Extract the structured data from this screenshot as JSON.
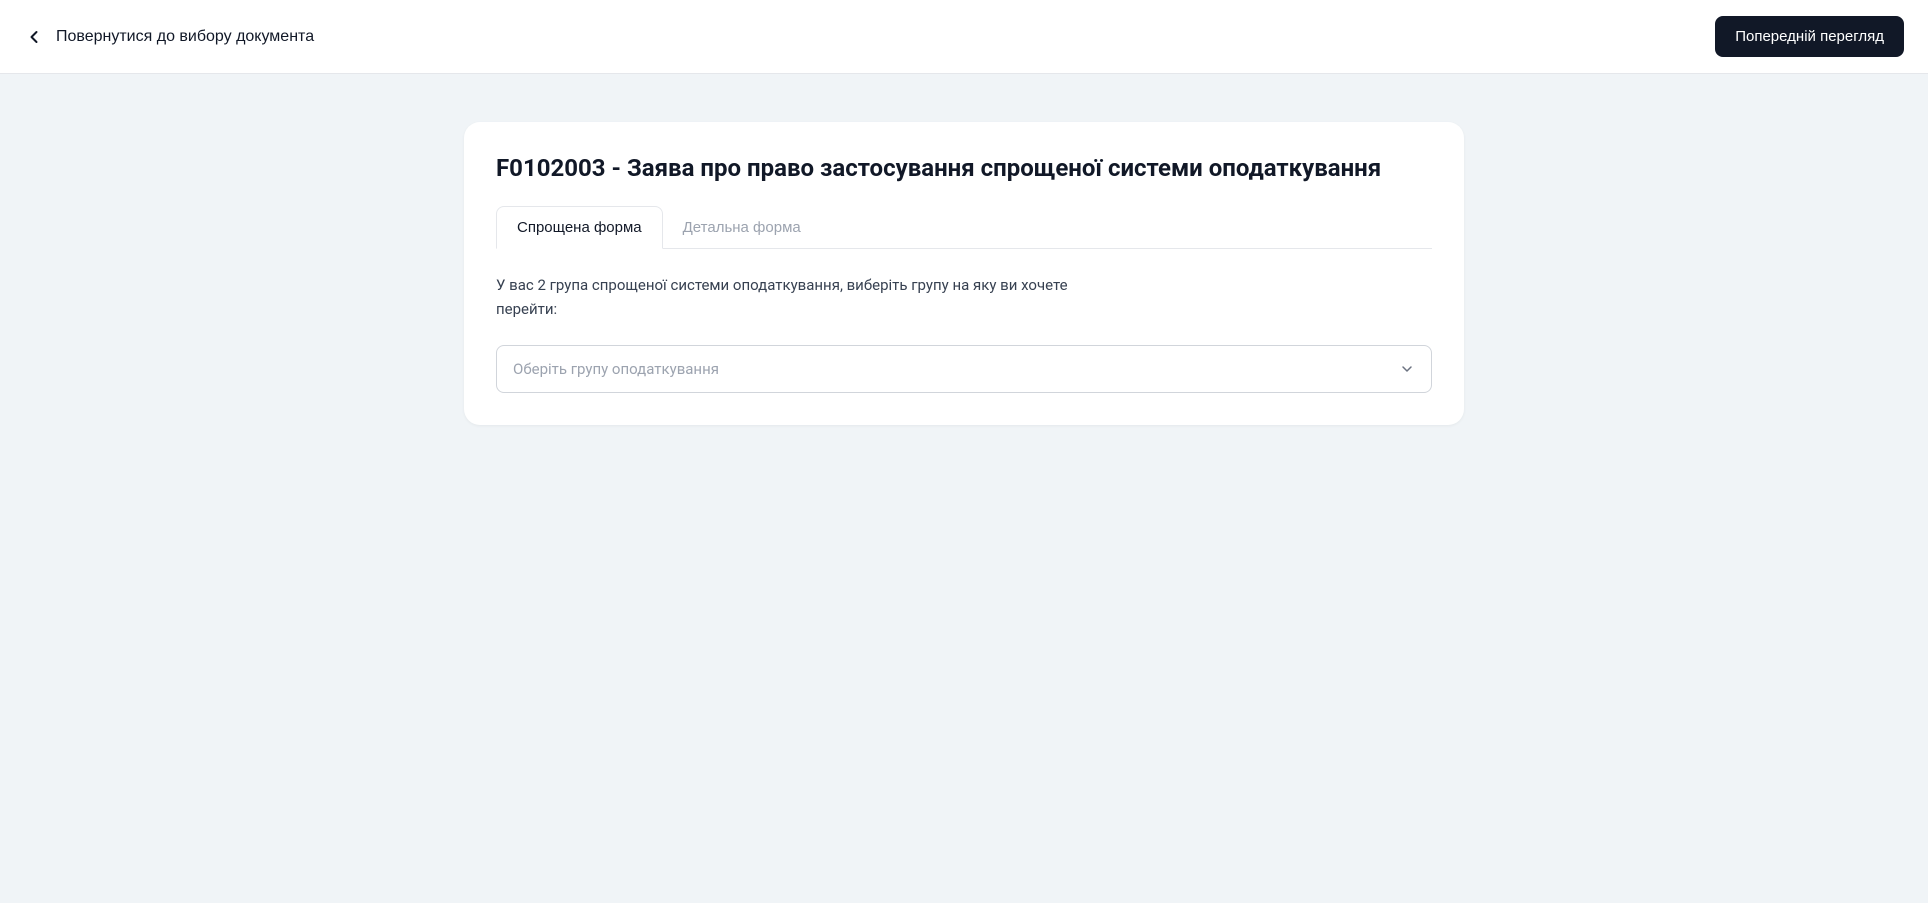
{
  "header": {
    "back_label": "Повернутися до вибору документа",
    "preview_label": "Попередній перегляд"
  },
  "card": {
    "title": "F0102003 - Заява про право застосування спрощеної системи оподаткування",
    "tabs": {
      "simplified": "Спрощена форма",
      "detailed": "Детальна форма"
    },
    "description": "У вас 2 група спрощеної системи оподаткування, виберіть групу на яку ви хочете перейти:",
    "select_placeholder": "Оберіть групу оподаткування"
  }
}
